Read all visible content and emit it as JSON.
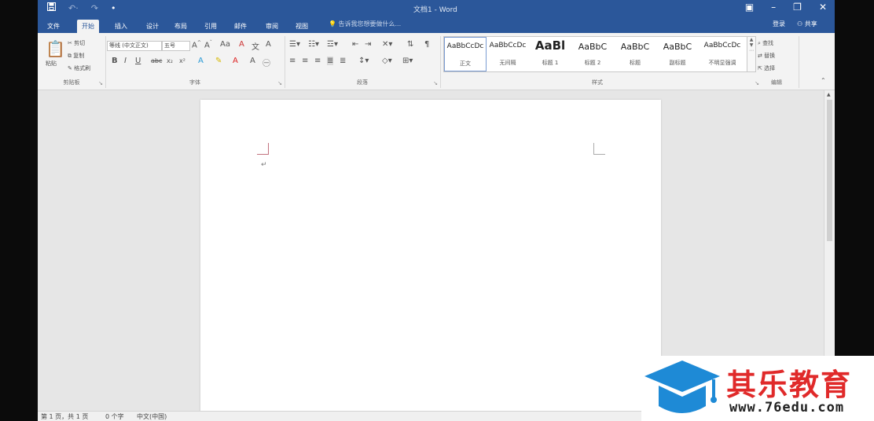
{
  "titlebar": {
    "save_icon": "save-icon",
    "undo_icon": "undo-icon",
    "redo_icon": "redo-icon",
    "doc_title": "文档1 - Word",
    "window_controls": [
      "ribbon-options-icon",
      "minimize-icon",
      "restore-icon",
      "close-icon"
    ]
  },
  "tabs": {
    "items": [
      "文件",
      "开始",
      "插入",
      "设计",
      "布局",
      "引用",
      "邮件",
      "审阅",
      "视图"
    ],
    "active": "开始",
    "tell_me": "告诉我您想要做什么...",
    "login": "登录",
    "share": "共享"
  },
  "clipboard": {
    "paste": "粘贴",
    "cut": "剪切",
    "copy": "复制",
    "format_painter": "格式刷",
    "label": "剪贴板"
  },
  "font": {
    "name": "等线 (中文正文)",
    "size": "五号",
    "label": "字体",
    "row2": [
      "B",
      "I",
      "U",
      "abc",
      "x₂",
      "x²"
    ]
  },
  "paragraph": {
    "label": "段落"
  },
  "styles": {
    "label": "样式",
    "items": [
      {
        "preview": "AaBbCcDc",
        "name": "正文"
      },
      {
        "preview": "AaBbCcDc",
        "name": "无间隔"
      },
      {
        "preview": "AaBl",
        "name": "标题 1"
      },
      {
        "preview": "AaBbC",
        "name": "标题 2"
      },
      {
        "preview": "AaBbC",
        "name": "标题"
      },
      {
        "preview": "AaBbC",
        "name": "副标题"
      },
      {
        "preview": "AaBbCcDc",
        "name": "不明显强调"
      }
    ]
  },
  "editing": {
    "find": "查找",
    "replace": "替换",
    "select": "选择",
    "label": "编辑"
  },
  "status": {
    "page": "第 1 页，共 1 页",
    "words": "0 个字",
    "lang": "中文(中国)"
  },
  "watermark": {
    "brand": "其乐教育",
    "url": "www.76edu.com",
    "colors": {
      "brand": "#e02a2a",
      "cap": "#1e8ad6"
    }
  }
}
